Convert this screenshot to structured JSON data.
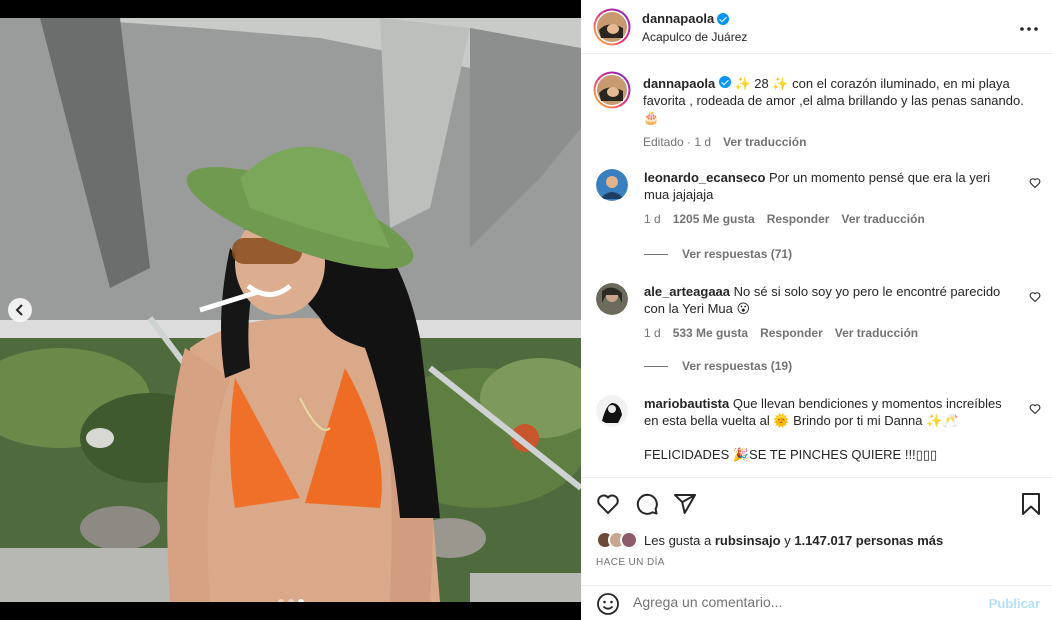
{
  "post": {
    "username": "dannapaola",
    "location": "Acapulco de Juárez",
    "carousel": {
      "count": 3,
      "active": 3
    }
  },
  "caption": {
    "username": "dannapaola",
    "text": "✨ 28 ✨ con el corazón iluminado, en mi playa favorita , rodeada de amor ,el alma brillando y las penas sanando. 🎂",
    "edited": "Editado",
    "time": "1 d",
    "translate": "Ver traducción"
  },
  "comments": [
    {
      "username": "leonardo_ecanseco",
      "text": "Por un momento pensé que era la yeri mua jajajaja",
      "time": "1 d",
      "likes": "1205 Me gusta",
      "reply": "Responder",
      "translate": "Ver traducción",
      "replies": "Ver respuestas (71)"
    },
    {
      "username": "ale_arteagaaa",
      "text": "No sé si solo soy yo pero le encontré parecido con la Yeri Mua 😮",
      "time": "1 d",
      "likes": "533 Me gusta",
      "reply": "Responder",
      "translate": "Ver traducción",
      "replies": "Ver respuestas (19)"
    },
    {
      "username": "mariobautista",
      "text": "Que llevan bendiciones y momentos increíbles en esta bella vuelta al 🌞 Brindo por ti mi Danna ✨🥂",
      "text2": "FELICIDADES 🎉SE TE PINCHES QUIERE !!!▯▯▯"
    }
  ],
  "likes": {
    "prefix": "Les gusta a",
    "user": "rubsinsajo",
    "connector": "y",
    "others": "1.147.017 personas más"
  },
  "timestamp": "HACE UN DÍA",
  "add_comment": {
    "placeholder": "Agrega un comentario...",
    "post_label": "Publicar"
  },
  "colors": {
    "verified": "#0095f6",
    "muted_text": "#737373",
    "post_button": "#b2dffc"
  },
  "icons": [
    "verified-icon",
    "more-icon",
    "heart-icon",
    "comment-icon",
    "share-icon",
    "bookmark-icon",
    "emoji-icon",
    "chevron-left-icon"
  ]
}
